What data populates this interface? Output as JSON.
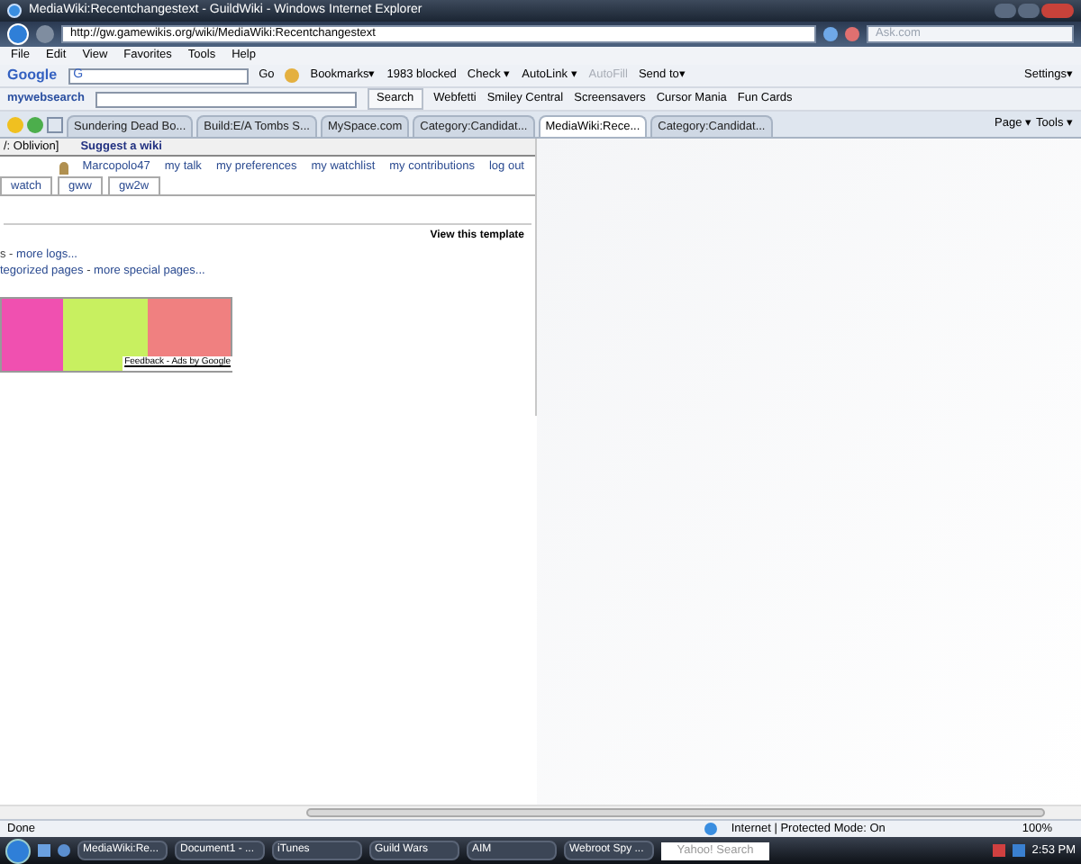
{
  "window": {
    "title": "MediaWiki:Recentchangestext - GuildWiki - Windows Internet Explorer"
  },
  "address": {
    "url": "http://gw.gamewikis.org/wiki/MediaWiki:Recentchangestext",
    "search_placeholder": "Ask.com"
  },
  "menu": [
    "File",
    "Edit",
    "View",
    "Favorites",
    "Tools",
    "Help"
  ],
  "google_toolbar": {
    "logo": "Google",
    "field": "G",
    "go": "Go",
    "buttons": [
      {
        "label": "Bookmarks▾",
        "disabled": false
      },
      {
        "label": "1983 blocked",
        "disabled": false
      },
      {
        "label": "Check ▾",
        "disabled": false
      },
      {
        "label": "AutoLink ▾",
        "disabled": false
      },
      {
        "label": "AutoFill",
        "disabled": true
      },
      {
        "label": "Send to▾",
        "disabled": false
      }
    ],
    "settings": "Settings▾"
  },
  "websearch_toolbar": {
    "logo": "mywebsearch",
    "search": "Search",
    "links": [
      "Webfetti",
      "Smiley Central",
      "Screensavers",
      "Cursor Mania",
      "Fun Cards"
    ]
  },
  "tabs": [
    {
      "label": "Sundering Dead Bo...",
      "selected": false
    },
    {
      "label": "Build:E/A Tombs S...",
      "selected": false
    },
    {
      "label": "MySpace.com",
      "selected": false
    },
    {
      "label": "Category:Candidat...",
      "selected": false
    },
    {
      "label": "MediaWiki:Rece...",
      "selected": true
    },
    {
      "label": "Category:Candidat...",
      "selected": false
    }
  ],
  "command_bar": [
    "Page ▾",
    "Tools ▾"
  ],
  "page": {
    "top_links": [
      "/: Oblivion]",
      "Suggest a wiki"
    ],
    "user_links": [
      "Marcopolo47",
      "my talk",
      "my preferences",
      "my watchlist",
      "my contributions",
      "log out"
    ],
    "wiki_tabs": [
      "watch",
      "gww",
      "gw2w"
    ],
    "view_template": "View this template",
    "log_line": [
      {
        "text": "s - ",
        "link": false
      },
      {
        "text": "more logs...",
        "link": true
      }
    ],
    "pages_line": [
      {
        "text": "tegorized pages",
        "link": true
      },
      {
        "text": " - ",
        "link": false
      },
      {
        "text": "more special pages...",
        "link": true
      }
    ],
    "ad_footer": "Feedback - Ads by Google"
  },
  "status_bar": {
    "text": "Done",
    "zone": "Internet | Protected Mode: On",
    "zoom": "100%"
  },
  "taskbar": {
    "buttons": [
      "MediaWiki:Re...",
      "Document1 - ...",
      "iTunes",
      "Guild Wars",
      "AIM",
      "Webroot Spy ..."
    ],
    "search": "Yahoo! Search",
    "clock": "2:53 PM"
  }
}
